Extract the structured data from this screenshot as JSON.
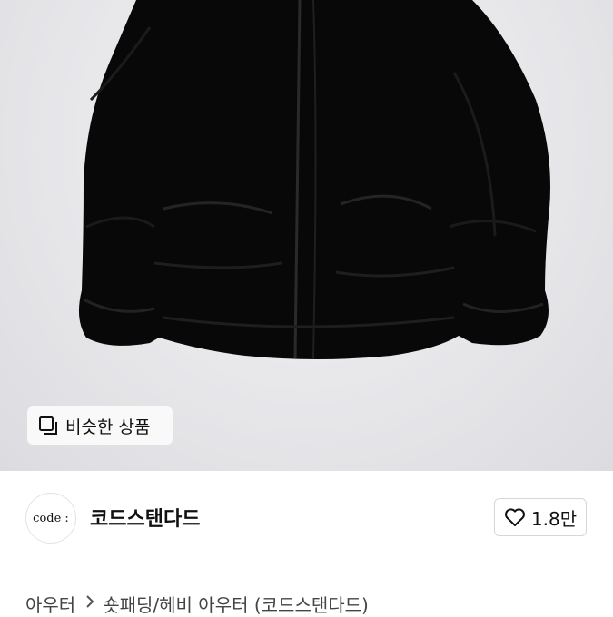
{
  "hero": {
    "image_icon": "jacket-photo",
    "similar_button": {
      "icon": "square-stack-icon",
      "label": "비슷한 상품"
    }
  },
  "seller": {
    "avatar_text": "code :",
    "name": "코드스탠다드",
    "like": {
      "icon": "heart-outline-icon",
      "count": "1.8만"
    }
  },
  "breadcrumb": {
    "items": [
      "아우터",
      "숏패딩/헤비 아우터 (코드스탠다드)"
    ],
    "separator_icon": "chevron-right-icon"
  }
}
